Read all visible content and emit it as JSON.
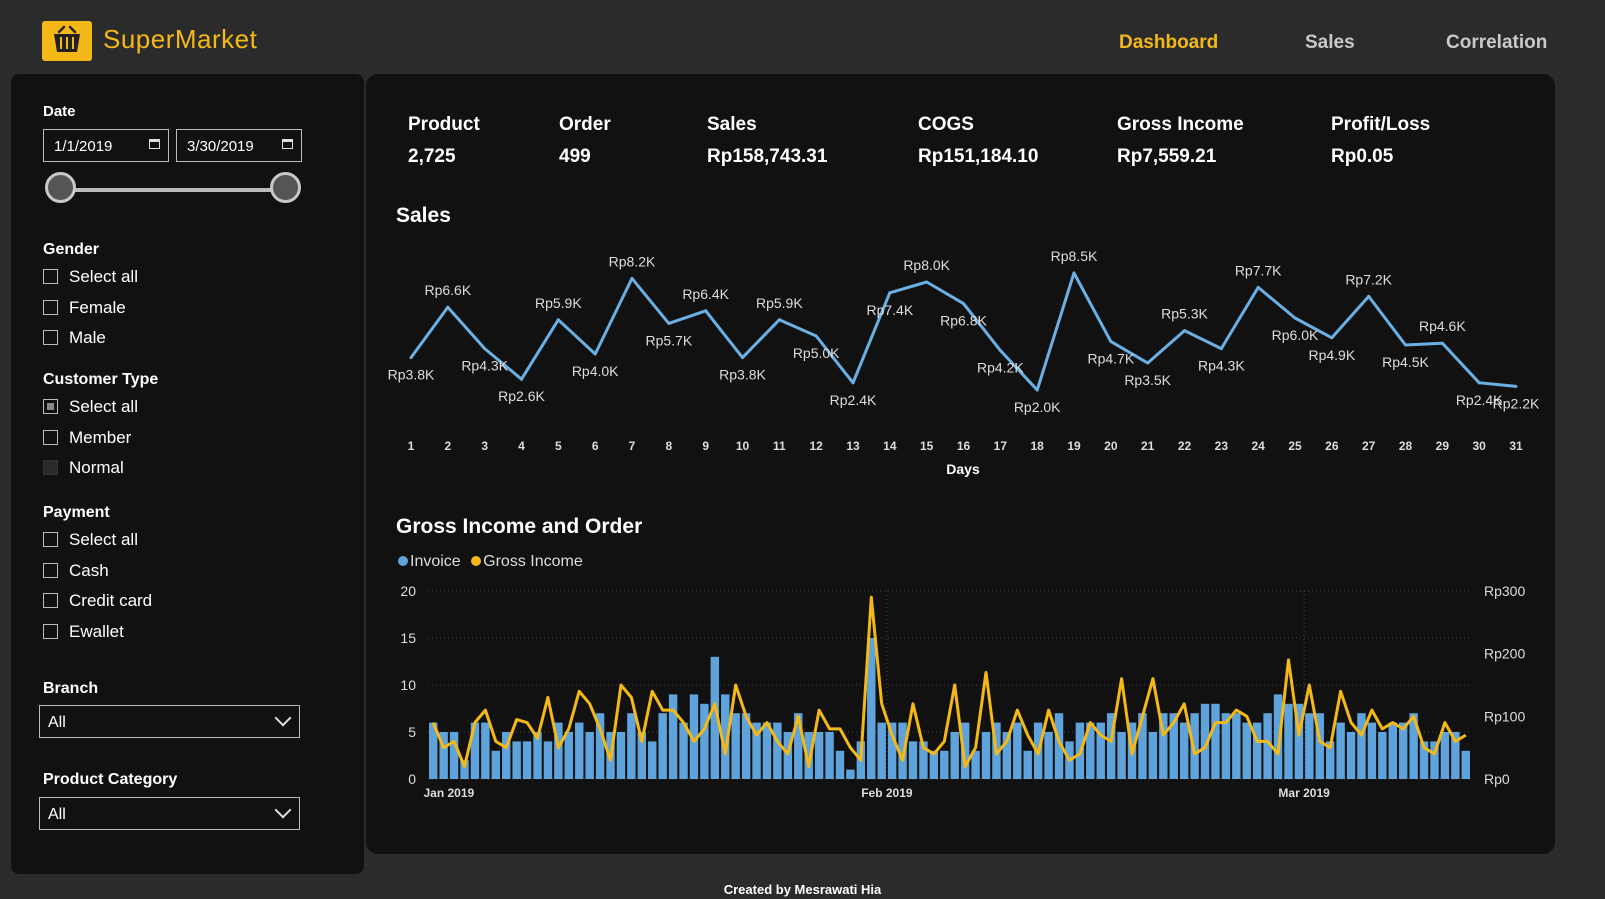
{
  "app": {
    "title": "SuperMarket",
    "footer": "Created by Mesrawati Hia"
  },
  "nav": [
    "Dashboard",
    "Sales",
    "Correlation"
  ],
  "filters": {
    "date": {
      "label": "Date",
      "start": "1/1/2019",
      "end": "3/30/2019"
    },
    "gender": {
      "label": "Gender",
      "options": [
        "Select all",
        "Female",
        "Male"
      ]
    },
    "customer_type": {
      "label": "Customer Type",
      "options": [
        "Select all",
        "Member",
        "Normal"
      ]
    },
    "payment": {
      "label": "Payment",
      "options": [
        "Select all",
        "Cash",
        "Credit card",
        "Ewallet"
      ]
    },
    "branch": {
      "label": "Branch",
      "value": "All"
    },
    "product_category": {
      "label": "Product Category",
      "value": "All"
    }
  },
  "kpis": [
    {
      "label": "Product",
      "value": "2,725"
    },
    {
      "label": "Order",
      "value": "499"
    },
    {
      "label": "Sales",
      "value": "Rp158,743.31"
    },
    {
      "label": "COGS",
      "value": "Rp151,184.10"
    },
    {
      "label": "Gross Income",
      "value": "Rp7,559.21"
    },
    {
      "label": "Profit/Loss",
      "value": "Rp0.05"
    }
  ],
  "colors": {
    "accent": "#f5b917",
    "invoice": "#5ea3dc",
    "gross_income": "#f5b917",
    "line": "#6ab0e4"
  },
  "chart_data": [
    {
      "type": "line",
      "title": "Sales",
      "xlabel": "Days",
      "x": [
        1,
        2,
        3,
        4,
        5,
        6,
        7,
        8,
        9,
        10,
        11,
        12,
        13,
        14,
        15,
        16,
        17,
        18,
        19,
        20,
        21,
        22,
        23,
        24,
        25,
        26,
        27,
        28,
        29,
        30,
        31
      ],
      "values": [
        3.8,
        6.6,
        4.3,
        2.6,
        5.9,
        4.0,
        8.2,
        5.7,
        6.4,
        3.8,
        5.9,
        5.0,
        2.4,
        7.4,
        8.0,
        6.8,
        4.2,
        2.0,
        8.5,
        4.7,
        3.5,
        5.3,
        4.3,
        7.7,
        6.0,
        4.9,
        7.2,
        4.5,
        4.6,
        2.4,
        2.2
      ],
      "labels": [
        "Rp3.8K",
        "Rp6.6K",
        "Rp4.3K",
        "Rp2.6K",
        "Rp5.9K",
        "Rp4.0K",
        "Rp8.2K",
        "Rp5.7K",
        "Rp6.4K",
        "Rp3.8K",
        "Rp5.9K",
        "Rp5.0K",
        "Rp2.4K",
        "Rp7.4K",
        "Rp8.0K",
        "Rp6.8K",
        "Rp4.2K",
        "Rp2.0K",
        "Rp8.5K",
        "Rp4.7K",
        "Rp3.5K",
        "Rp5.3K",
        "Rp4.3K",
        "Rp7.7K",
        "Rp6.0K",
        "Rp4.9K",
        "Rp7.2K",
        "Rp4.5K",
        "Rp4.6K",
        "Rp2.4K",
        "Rp2.2K"
      ],
      "ylim": [
        1.5,
        9
      ]
    },
    {
      "type": "bar",
      "title": "Gross Income and Order",
      "series": [
        {
          "name": "Invoice",
          "axis": "left",
          "values": [
            6,
            5,
            5,
            2,
            6,
            6,
            3,
            5,
            4,
            4,
            5,
            4,
            6,
            5,
            6,
            5,
            7,
            5,
            5,
            7,
            5,
            4,
            7,
            9,
            6,
            9,
            8,
            13,
            9,
            7,
            7,
            6,
            6,
            6,
            5,
            7,
            5,
            5,
            5,
            3,
            1,
            4,
            15,
            6,
            6,
            6,
            4,
            4,
            3,
            3,
            5,
            6,
            3,
            5,
            6,
            5,
            6,
            3,
            6,
            5,
            7,
            4,
            6,
            6,
            6,
            7,
            5,
            6,
            7,
            5,
            7,
            7,
            6,
            7,
            8,
            8,
            7,
            7,
            6,
            6,
            7,
            9,
            8,
            8,
            7,
            7,
            4,
            6,
            5,
            7,
            6,
            5,
            6,
            6,
            7,
            4,
            4,
            5,
            5,
            3
          ]
        },
        {
          "name": "Gross Income",
          "axis": "right",
          "values": [
            90,
            50,
            60,
            20,
            90,
            110,
            60,
            50,
            95,
            90,
            65,
            130,
            50,
            80,
            140,
            120,
            80,
            30,
            150,
            130,
            60,
            140,
            110,
            110,
            90,
            60,
            80,
            120,
            40,
            150,
            100,
            70,
            90,
            60,
            40,
            100,
            20,
            110,
            80,
            80,
            50,
            30,
            290,
            120,
            70,
            30,
            120,
            50,
            40,
            60,
            150,
            20,
            50,
            170,
            40,
            60,
            110,
            70,
            40,
            110,
            60,
            30,
            40,
            90,
            70,
            60,
            160,
            40,
            100,
            160,
            70,
            90,
            120,
            40,
            50,
            90,
            90,
            110,
            100,
            60,
            60,
            40,
            190,
            70,
            150,
            60,
            50,
            140,
            90,
            70,
            110,
            80,
            90,
            80,
            100,
            50,
            40,
            90,
            60,
            70
          ]
        }
      ],
      "x_ticks": [
        "Jan 2019",
        "Feb 2019",
        "Mar 2019"
      ],
      "y_left_ticks": [
        "20",
        "15",
        "10",
        "5",
        "0"
      ],
      "y_right_ticks": [
        "Rp300",
        "Rp200",
        "Rp100",
        "Rp0"
      ],
      "ylim_left": [
        0,
        20
      ],
      "ylim_right": [
        0,
        300
      ],
      "grid": true
    }
  ]
}
